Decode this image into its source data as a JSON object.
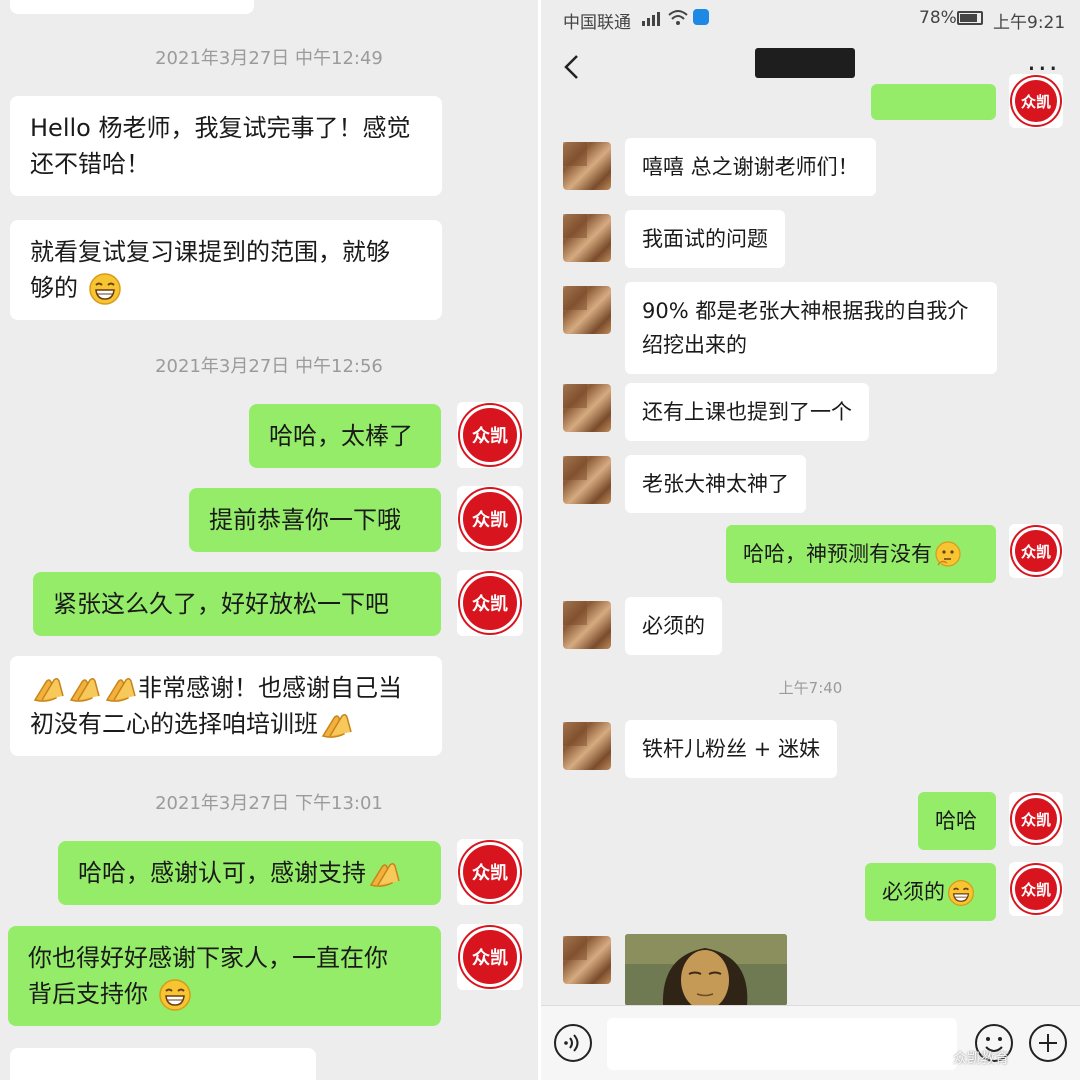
{
  "left_panel": {
    "timestamps": [
      "2021年3月27日 中午12:49",
      "2021年3月27日 中午12:56",
      "2021年3月27日 下午13:01"
    ],
    "messages": [
      "Hello 杨老师，我复试完事了！感觉",
      "还不错哈！",
      "就看复试复习课提到的范围，就够",
      "够的",
      "哈哈，太棒了",
      "提前恭喜你一下哦",
      "紧张这么久了，好好放松一下吧",
      "非常感谢！也感谢自己当",
      "初没有二心的选择咱培训班",
      "哈哈，感谢认可，感谢支持",
      "你也得好好感谢下家人，一直在你",
      "背后支持你"
    ],
    "logo_text": "众凯"
  },
  "right_panel": {
    "status": {
      "carrier": "中国联通",
      "battery": "78%",
      "time": "上午9:21"
    },
    "timestamps": [
      "上午7:40"
    ],
    "messages": [
      "嘻嘻 总之谢谢老师们！",
      "我面试的问题",
      "90% 都是老张大神根据我的自我介",
      "绍挖出来的",
      "还有上课也提到了一个",
      "老张大神太神了",
      "哈哈，神预测有没有",
      "必须的",
      "铁杆儿粉丝 + 迷妹",
      "哈哈",
      "必须的"
    ],
    "logo_text": "众凯",
    "watermark": "众凯教育"
  },
  "colors": {
    "bubble_green": "#95ec69",
    "bubble_white": "#ffffff",
    "chat_bg": "#ededed",
    "logo_red": "#d8141e"
  },
  "icons": [
    "back-icon",
    "more-icon",
    "voice-icon",
    "emoji-icon",
    "add-icon",
    "grinning-emoji",
    "clapping-hands-emoji",
    "thinking-emoji",
    "wifi-icon",
    "signal-icon",
    "battery-icon"
  ]
}
